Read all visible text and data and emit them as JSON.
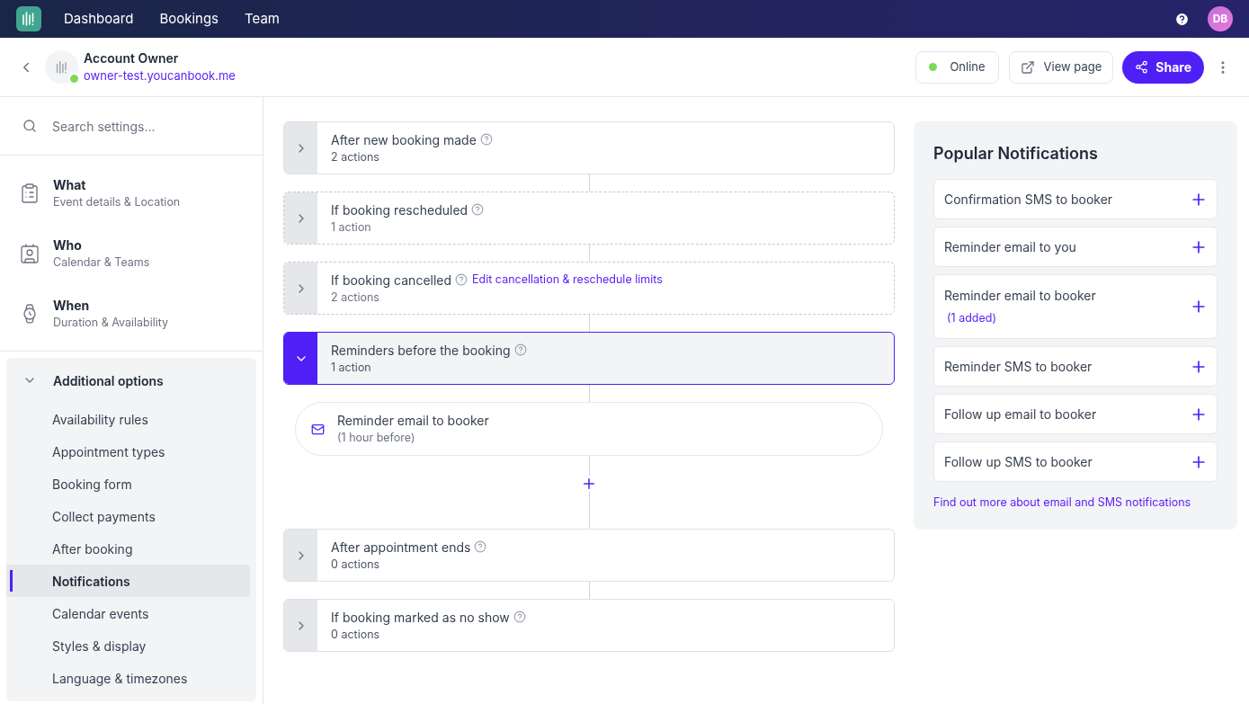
{
  "nav": {
    "items": [
      "Dashboard",
      "Bookings",
      "Team"
    ],
    "avatar": "DB"
  },
  "header": {
    "title": "Account Owner",
    "url": "owner-test.youcanbook.me",
    "status": {
      "label": "Online",
      "online": true
    },
    "view_page": "View page",
    "share": "Share"
  },
  "sidebar": {
    "search": {
      "placeholder": "Search settings..."
    },
    "sections": [
      {
        "title": "What",
        "subtitle": "Event details & Location"
      },
      {
        "title": "Who",
        "subtitle": "Calendar & Teams"
      },
      {
        "title": "When",
        "subtitle": "Duration & Availability"
      }
    ],
    "additional": {
      "title": "Additional options",
      "expanded": true,
      "items": [
        {
          "label": "Availability rules",
          "selected": false
        },
        {
          "label": "Appointment types",
          "selected": false
        },
        {
          "label": "Booking form",
          "selected": false
        },
        {
          "label": "Collect payments",
          "selected": false
        },
        {
          "label": "After booking",
          "selected": false
        },
        {
          "label": "Notifications",
          "selected": true
        },
        {
          "label": "Calendar events",
          "selected": false
        },
        {
          "label": "Styles & display",
          "selected": false
        },
        {
          "label": "Language & timezones",
          "selected": false
        }
      ]
    }
  },
  "triggers": [
    {
      "title": "After new booking made",
      "count": "2 actions",
      "active": true,
      "expanded": false
    },
    {
      "title": "If booking rescheduled",
      "count": "1 action",
      "active": false,
      "expanded": false
    },
    {
      "title": "If booking cancelled",
      "count": "2 actions",
      "active": false,
      "expanded": false,
      "link": "Edit cancellation & reschedule limits"
    },
    {
      "title": "Reminders before the booking",
      "count": "1 action",
      "active": true,
      "expanded": true,
      "actions": [
        {
          "title": "Reminder email to booker",
          "detail": "(1 hour before)"
        }
      ]
    },
    {
      "title": "After appointment ends",
      "count": "0 actions",
      "active": true,
      "expanded": false
    },
    {
      "title": "If booking marked as no show",
      "count": "0 actions",
      "active": true,
      "expanded": false
    }
  ],
  "popular": {
    "title": "Popular Notifications",
    "items": [
      {
        "label": "Confirmation SMS to booker"
      },
      {
        "label": "Reminder email to you"
      },
      {
        "label": "Reminder email to booker",
        "added": "(1 added)"
      },
      {
        "label": "Reminder SMS to booker"
      },
      {
        "label": "Follow up email to booker"
      },
      {
        "label": "Follow up SMS to booker"
      }
    ],
    "link": "Find out more about email and SMS notifications"
  }
}
